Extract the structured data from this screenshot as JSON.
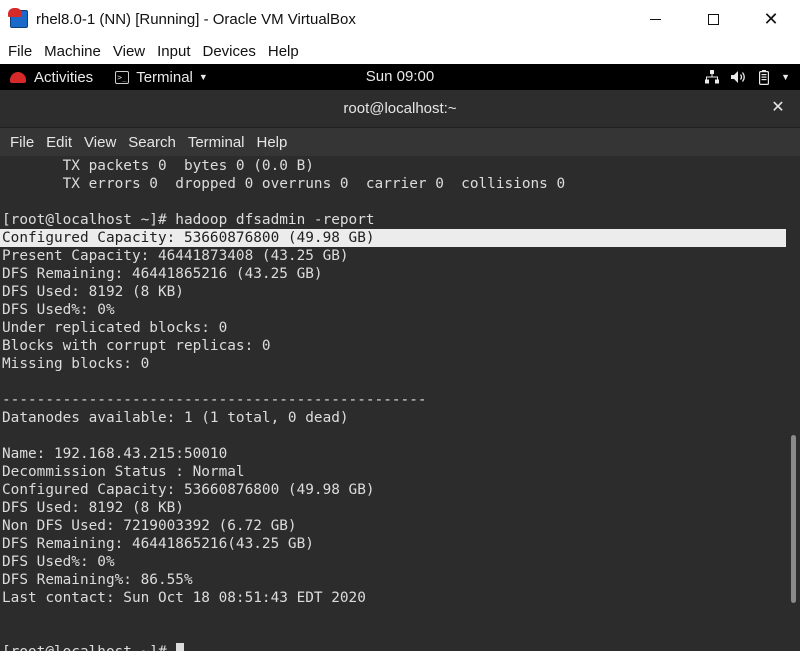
{
  "vbox": {
    "title": "rhel8.0-1 (NN) [Running] - Oracle VM VirtualBox",
    "menu": [
      "File",
      "Machine",
      "View",
      "Input",
      "Devices",
      "Help"
    ]
  },
  "gnome": {
    "activities": "Activities",
    "app_menu": "Terminal",
    "clock": "Sun 09:00",
    "icons": [
      "network-icon",
      "volume-icon",
      "battery-icon",
      "system-menu-caret-icon"
    ]
  },
  "terminal": {
    "title": "root@localhost:~",
    "menu": [
      "File",
      "Edit",
      "View",
      "Search",
      "Terminal",
      "Help"
    ],
    "scroll_position": 0.84,
    "lines": [
      "       TX packets 0  bytes 0 (0.0 B)",
      "       TX errors 0  dropped 0 overruns 0  carrier 0  collisions 0",
      "",
      "[root@localhost ~]# hadoop dfsadmin -report",
      "Configured Capacity: 53660876800 (49.98 GB)",
      "Present Capacity: 46441873408 (43.25 GB)",
      "DFS Remaining: 46441865216 (43.25 GB)",
      "DFS Used: 8192 (8 KB)",
      "DFS Used%: 0%",
      "Under replicated blocks: 0",
      "Blocks with corrupt replicas: 0",
      "Missing blocks: 0",
      "",
      "-------------------------------------------------",
      "Datanodes available: 1 (1 total, 0 dead)",
      "",
      "Name: 192.168.43.215:50010",
      "Decommission Status : Normal",
      "Configured Capacity: 53660876800 (49.98 GB)",
      "DFS Used: 8192 (8 KB)",
      "Non DFS Used: 7219003392 (6.72 GB)",
      "DFS Remaining: 46441865216(43.25 GB)",
      "DFS Used%: 0%",
      "DFS Remaining%: 86.55%",
      "Last contact: Sun Oct 18 08:51:43 EDT 2020",
      "",
      "",
      "[root@localhost ~]# "
    ],
    "highlighted_line": 4
  }
}
